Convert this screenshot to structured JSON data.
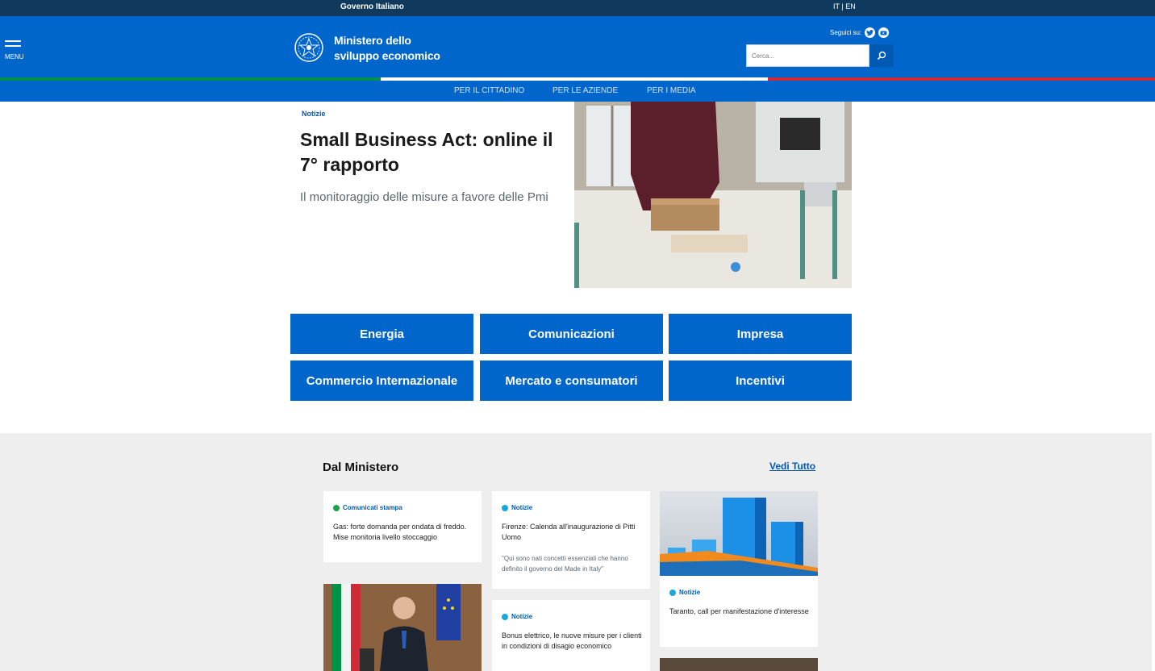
{
  "topbar": {
    "gov_name": "Governo Italiano",
    "lang_it": "IT",
    "lang_sep": " | ",
    "lang_en": "EN"
  },
  "header": {
    "menu_label": "MENU",
    "brand_line1": "Ministero dello",
    "brand_line2": "sviluppo economico",
    "social_label": "Seguici su:",
    "search_placeholder": "Cerca..."
  },
  "subnav": {
    "items": [
      "PER IL CITTADINO",
      "PER LE AZIENDE",
      "PER I MEDIA"
    ]
  },
  "hero": {
    "tag": "Notizie",
    "title": "Small Business Act: online il 7° rapporto",
    "subtitle": "Il monitoraggio delle misure a favore delle Pmi"
  },
  "categories": [
    "Energia",
    "Comunicazioni",
    "Impresa",
    "Commercio Internazionale",
    "Mercato e consumatori",
    "Incentivi"
  ],
  "ministero": {
    "title": "Dal Ministero",
    "see_all": "Vedi Tutto",
    "cards": [
      {
        "tag": "Comunicati stampa",
        "title": "Gas: forte domanda per ondata di freddo. Mise monitoria livello stoccaggio"
      },
      {
        "tag": "Notizie",
        "title": "Firenze: Calenda all'inaugurazione di Pitti Uomo",
        "quote": "\"Qui sono nati concetti essenziali che hanno definito il governo del Made in Italy\""
      },
      {
        "tag": "Notizie",
        "title": "Taranto, call per manifestazione d'interesse"
      },
      {
        "tag": "Notizie",
        "title": "Bonus elettrico, le nuove misure per i clienti in condizioni di disagio economico"
      }
    ]
  },
  "colors": {
    "primary": "#0066cc",
    "topbar": "#0f3a5e",
    "green_dot": "#1aa34a",
    "cyan_dot": "#18a8d8"
  }
}
